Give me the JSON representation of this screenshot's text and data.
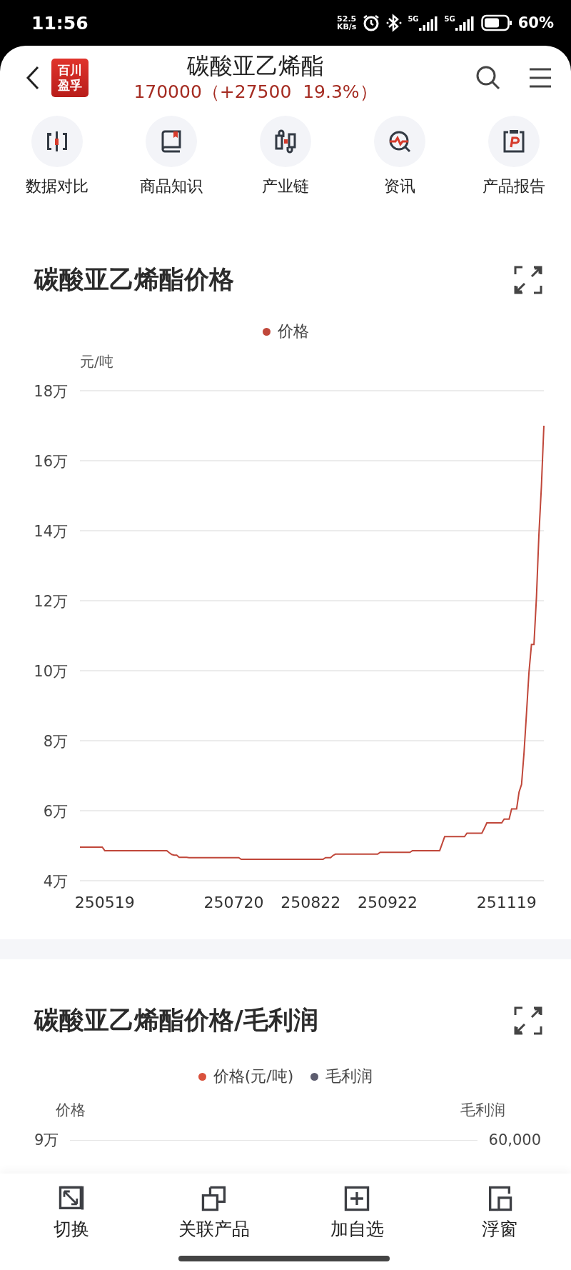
{
  "status_bar": {
    "time": "11:56",
    "net_speed_value": "52.5",
    "net_speed_unit": "KB/s",
    "signals": [
      {
        "label": "5G"
      },
      {
        "label": "5G"
      }
    ],
    "battery": "60%"
  },
  "header": {
    "logo_lines": [
      "百川",
      "盈孚"
    ],
    "title": "碳酸亚乙烯酯",
    "quote": "170000（+27500  19.3%）"
  },
  "shortcuts": [
    {
      "label": "数据对比",
      "kind": "compare"
    },
    {
      "label": "商品知识",
      "kind": "book"
    },
    {
      "label": "产业链",
      "kind": "chain"
    },
    {
      "label": "资讯",
      "kind": "news"
    },
    {
      "label": "产品报告",
      "kind": "report"
    }
  ],
  "price_chart": {
    "title": "碳酸亚乙烯酯价格",
    "chart_data": {
      "type": "line",
      "ylabel": "元/吨",
      "grid": true,
      "categories": [
        null,
        null,
        null,
        null,
        null,
        null,
        null,
        null,
        null,
        null,
        "250519",
        null,
        null,
        null,
        null,
        null,
        null,
        null,
        null,
        null,
        null,
        null,
        null,
        null,
        null,
        null,
        null,
        null,
        null,
        null,
        null,
        null,
        null,
        null,
        null,
        null,
        null,
        null,
        null,
        null,
        null,
        null,
        null,
        null,
        null,
        null,
        null,
        null,
        null,
        null,
        null,
        null,
        null,
        null,
        null,
        null,
        null,
        null,
        null,
        null,
        null,
        null,
        "250720",
        null,
        null,
        null,
        null,
        null,
        null,
        null,
        null,
        null,
        null,
        null,
        null,
        null,
        null,
        null,
        null,
        null,
        null,
        null,
        null,
        null,
        null,
        null,
        null,
        null,
        null,
        null,
        null,
        null,
        null,
        "250822",
        null,
        null,
        null,
        null,
        null,
        null,
        null,
        null,
        null,
        null,
        null,
        null,
        null,
        null,
        null,
        null,
        null,
        null,
        null,
        null,
        null,
        null,
        null,
        null,
        null,
        null,
        null,
        null,
        null,
        null,
        "250922",
        null,
        null,
        null,
        null,
        null,
        null,
        null,
        null,
        null,
        null,
        null,
        null,
        null,
        null,
        null,
        null,
        null,
        null,
        null,
        null,
        null,
        null,
        null,
        null,
        null,
        null,
        null,
        null,
        null,
        null,
        null,
        null,
        null,
        null,
        null,
        null,
        null,
        null,
        null,
        null,
        null,
        null,
        null,
        null,
        null,
        null,
        null,
        "251119",
        null,
        null,
        null,
        null,
        null,
        null,
        null,
        null,
        null,
        null,
        null,
        null,
        null,
        null,
        null
      ],
      "series": [
        {
          "name": "价格",
          "color": "#c0473a",
          "values": [
            4.96,
            4.96,
            4.96,
            4.96,
            4.96,
            4.96,
            4.96,
            4.96,
            4.96,
            4.96,
            4.86,
            4.86,
            4.86,
            4.86,
            4.86,
            4.86,
            4.86,
            4.86,
            4.86,
            4.86,
            4.86,
            4.86,
            4.86,
            4.86,
            4.86,
            4.86,
            4.86,
            4.86,
            4.86,
            4.86,
            4.86,
            4.86,
            4.86,
            4.86,
            4.86,
            4.86,
            4.8,
            4.75,
            4.73,
            4.73,
            4.67,
            4.67,
            4.67,
            4.67,
            4.66,
            4.66,
            4.66,
            4.66,
            4.66,
            4.66,
            4.66,
            4.66,
            4.66,
            4.66,
            4.66,
            4.66,
            4.66,
            4.66,
            4.66,
            4.66,
            4.66,
            4.66,
            4.66,
            4.66,
            4.66,
            4.61,
            4.61,
            4.61,
            4.61,
            4.61,
            4.61,
            4.61,
            4.61,
            4.61,
            4.61,
            4.61,
            4.61,
            4.61,
            4.61,
            4.61,
            4.61,
            4.61,
            4.61,
            4.61,
            4.61,
            4.61,
            4.61,
            4.61,
            4.61,
            4.61,
            4.61,
            4.61,
            4.61,
            4.61,
            4.61,
            4.61,
            4.61,
            4.61,
            4.61,
            4.66,
            4.66,
            4.66,
            4.72,
            4.76,
            4.76,
            4.76,
            4.76,
            4.76,
            4.76,
            4.76,
            4.76,
            4.76,
            4.76,
            4.76,
            4.76,
            4.76,
            4.76,
            4.76,
            4.76,
            4.76,
            4.76,
            4.81,
            4.81,
            4.81,
            4.81,
            4.81,
            4.81,
            4.81,
            4.81,
            4.81,
            4.81,
            4.81,
            4.81,
            4.81,
            4.86,
            4.86,
            4.86,
            4.86,
            4.86,
            4.86,
            4.86,
            4.86,
            4.86,
            4.86,
            4.86,
            4.86,
            5.06,
            5.26,
            5.26,
            5.26,
            5.26,
            5.26,
            5.26,
            5.26,
            5.26,
            5.26,
            5.36,
            5.36,
            5.36,
            5.36,
            5.36,
            5.36,
            5.36,
            5.5,
            5.65,
            5.65,
            5.65,
            5.65,
            5.65,
            5.65,
            5.65,
            5.76,
            5.76,
            5.76,
            6.05,
            6.05,
            6.05,
            6.53,
            6.75,
            7.66,
            8.8,
            9.95,
            10.75,
            10.75,
            12.1,
            13.87,
            15.25,
            17
          ]
        }
      ],
      "ylim": [
        4,
        18
      ],
      "yticks": [
        {
          "value": 4,
          "label": "4万"
        },
        {
          "value": 6,
          "label": "6万"
        },
        {
          "value": 8,
          "label": "8万"
        },
        {
          "value": 10,
          "label": "10万"
        },
        {
          "value": 12,
          "label": "12万"
        },
        {
          "value": 14,
          "label": "14万"
        },
        {
          "value": 16,
          "label": "16万"
        },
        {
          "value": 18,
          "label": "18万"
        }
      ]
    }
  },
  "margin_chart": {
    "title": "碳酸亚乙烯酯价格/毛利润",
    "legend": [
      {
        "name": "价格(元/吨)",
        "color": "#d9513c"
      },
      {
        "name": "毛利润",
        "color": "#5c5c6e"
      }
    ],
    "left_axis": {
      "label": "价格",
      "tick": "9万"
    },
    "right_axis": {
      "label": "毛利润",
      "tick": "60,000"
    }
  },
  "toolbar": [
    {
      "label": "切换",
      "kind": "switch"
    },
    {
      "label": "关联产品",
      "kind": "related"
    },
    {
      "label": "加自选",
      "kind": "add"
    },
    {
      "label": "浮窗",
      "kind": "float"
    }
  ]
}
